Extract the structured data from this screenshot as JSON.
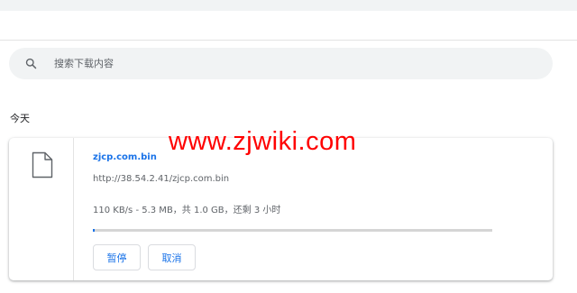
{
  "search": {
    "placeholder": "搜索下载内容",
    "icon": "search-icon"
  },
  "section": {
    "date_label": "今天"
  },
  "download": {
    "file_name": "zjcp.com.bin",
    "url": "http://38.54.2.41/zjcp.com.bin",
    "status": "110 KB/s - 5.3 MB，共 1.0 GB，还剩 3 小时",
    "progress": 0.005,
    "pause_label": "暂停",
    "cancel_label": "取消",
    "file_icon": "file-icon"
  },
  "watermark": {
    "text": "www.zjwiki.com"
  },
  "colors": {
    "accent": "#1a73e8",
    "watermark": "#ff0000",
    "search_bg": "#f1f3f4"
  }
}
